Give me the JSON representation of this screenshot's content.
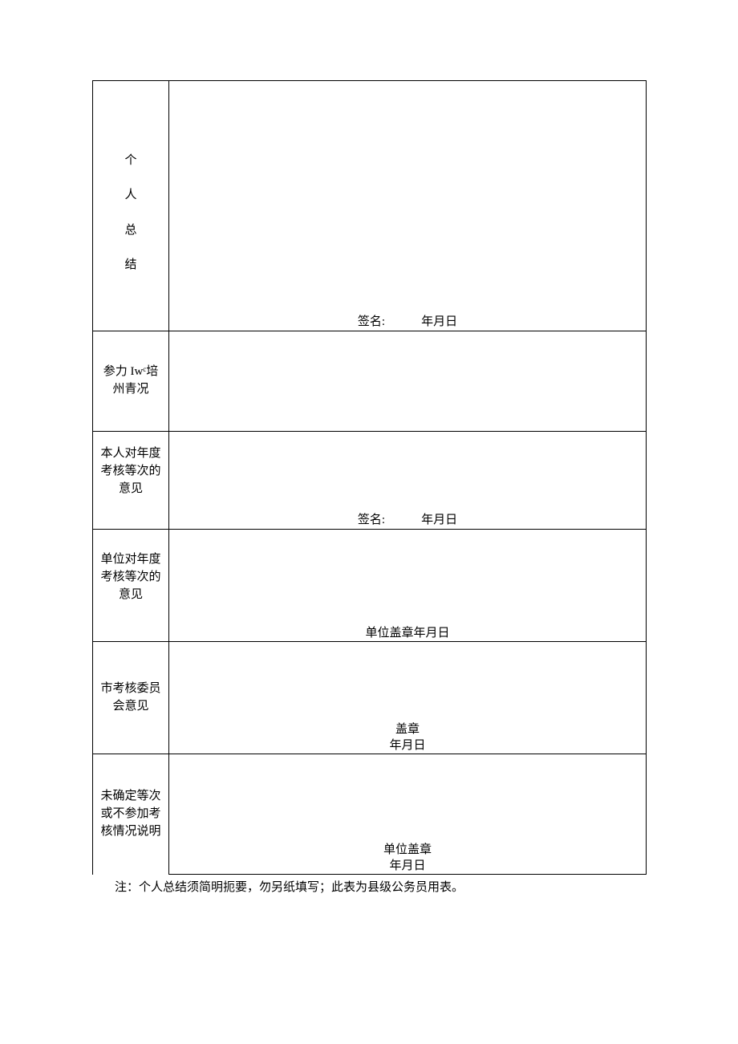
{
  "rows": {
    "personal_summary": {
      "label_chars": [
        "个",
        "人",
        "总",
        "结"
      ],
      "signature": "签名:            年月日"
    },
    "training": {
      "label": "参力 Iwᶜ培州青况"
    },
    "self_opinion": {
      "label": "本人对年度考核等次的意见",
      "signature": "签名:            年月日"
    },
    "unit_opinion": {
      "label": "单位对年度考核等次的意见",
      "signature": "单位盖章年月日"
    },
    "committee": {
      "label": "市考核委员会意见",
      "stamp": "盖章",
      "date": "年月日"
    },
    "unconfirmed": {
      "label": "未确定等次或不参加考核情况说明",
      "stamp": "单位盖章",
      "date": "年月日"
    }
  },
  "note": "注：个人总结须简明扼要，勿另纸填写；此表为县级公务员用表。"
}
